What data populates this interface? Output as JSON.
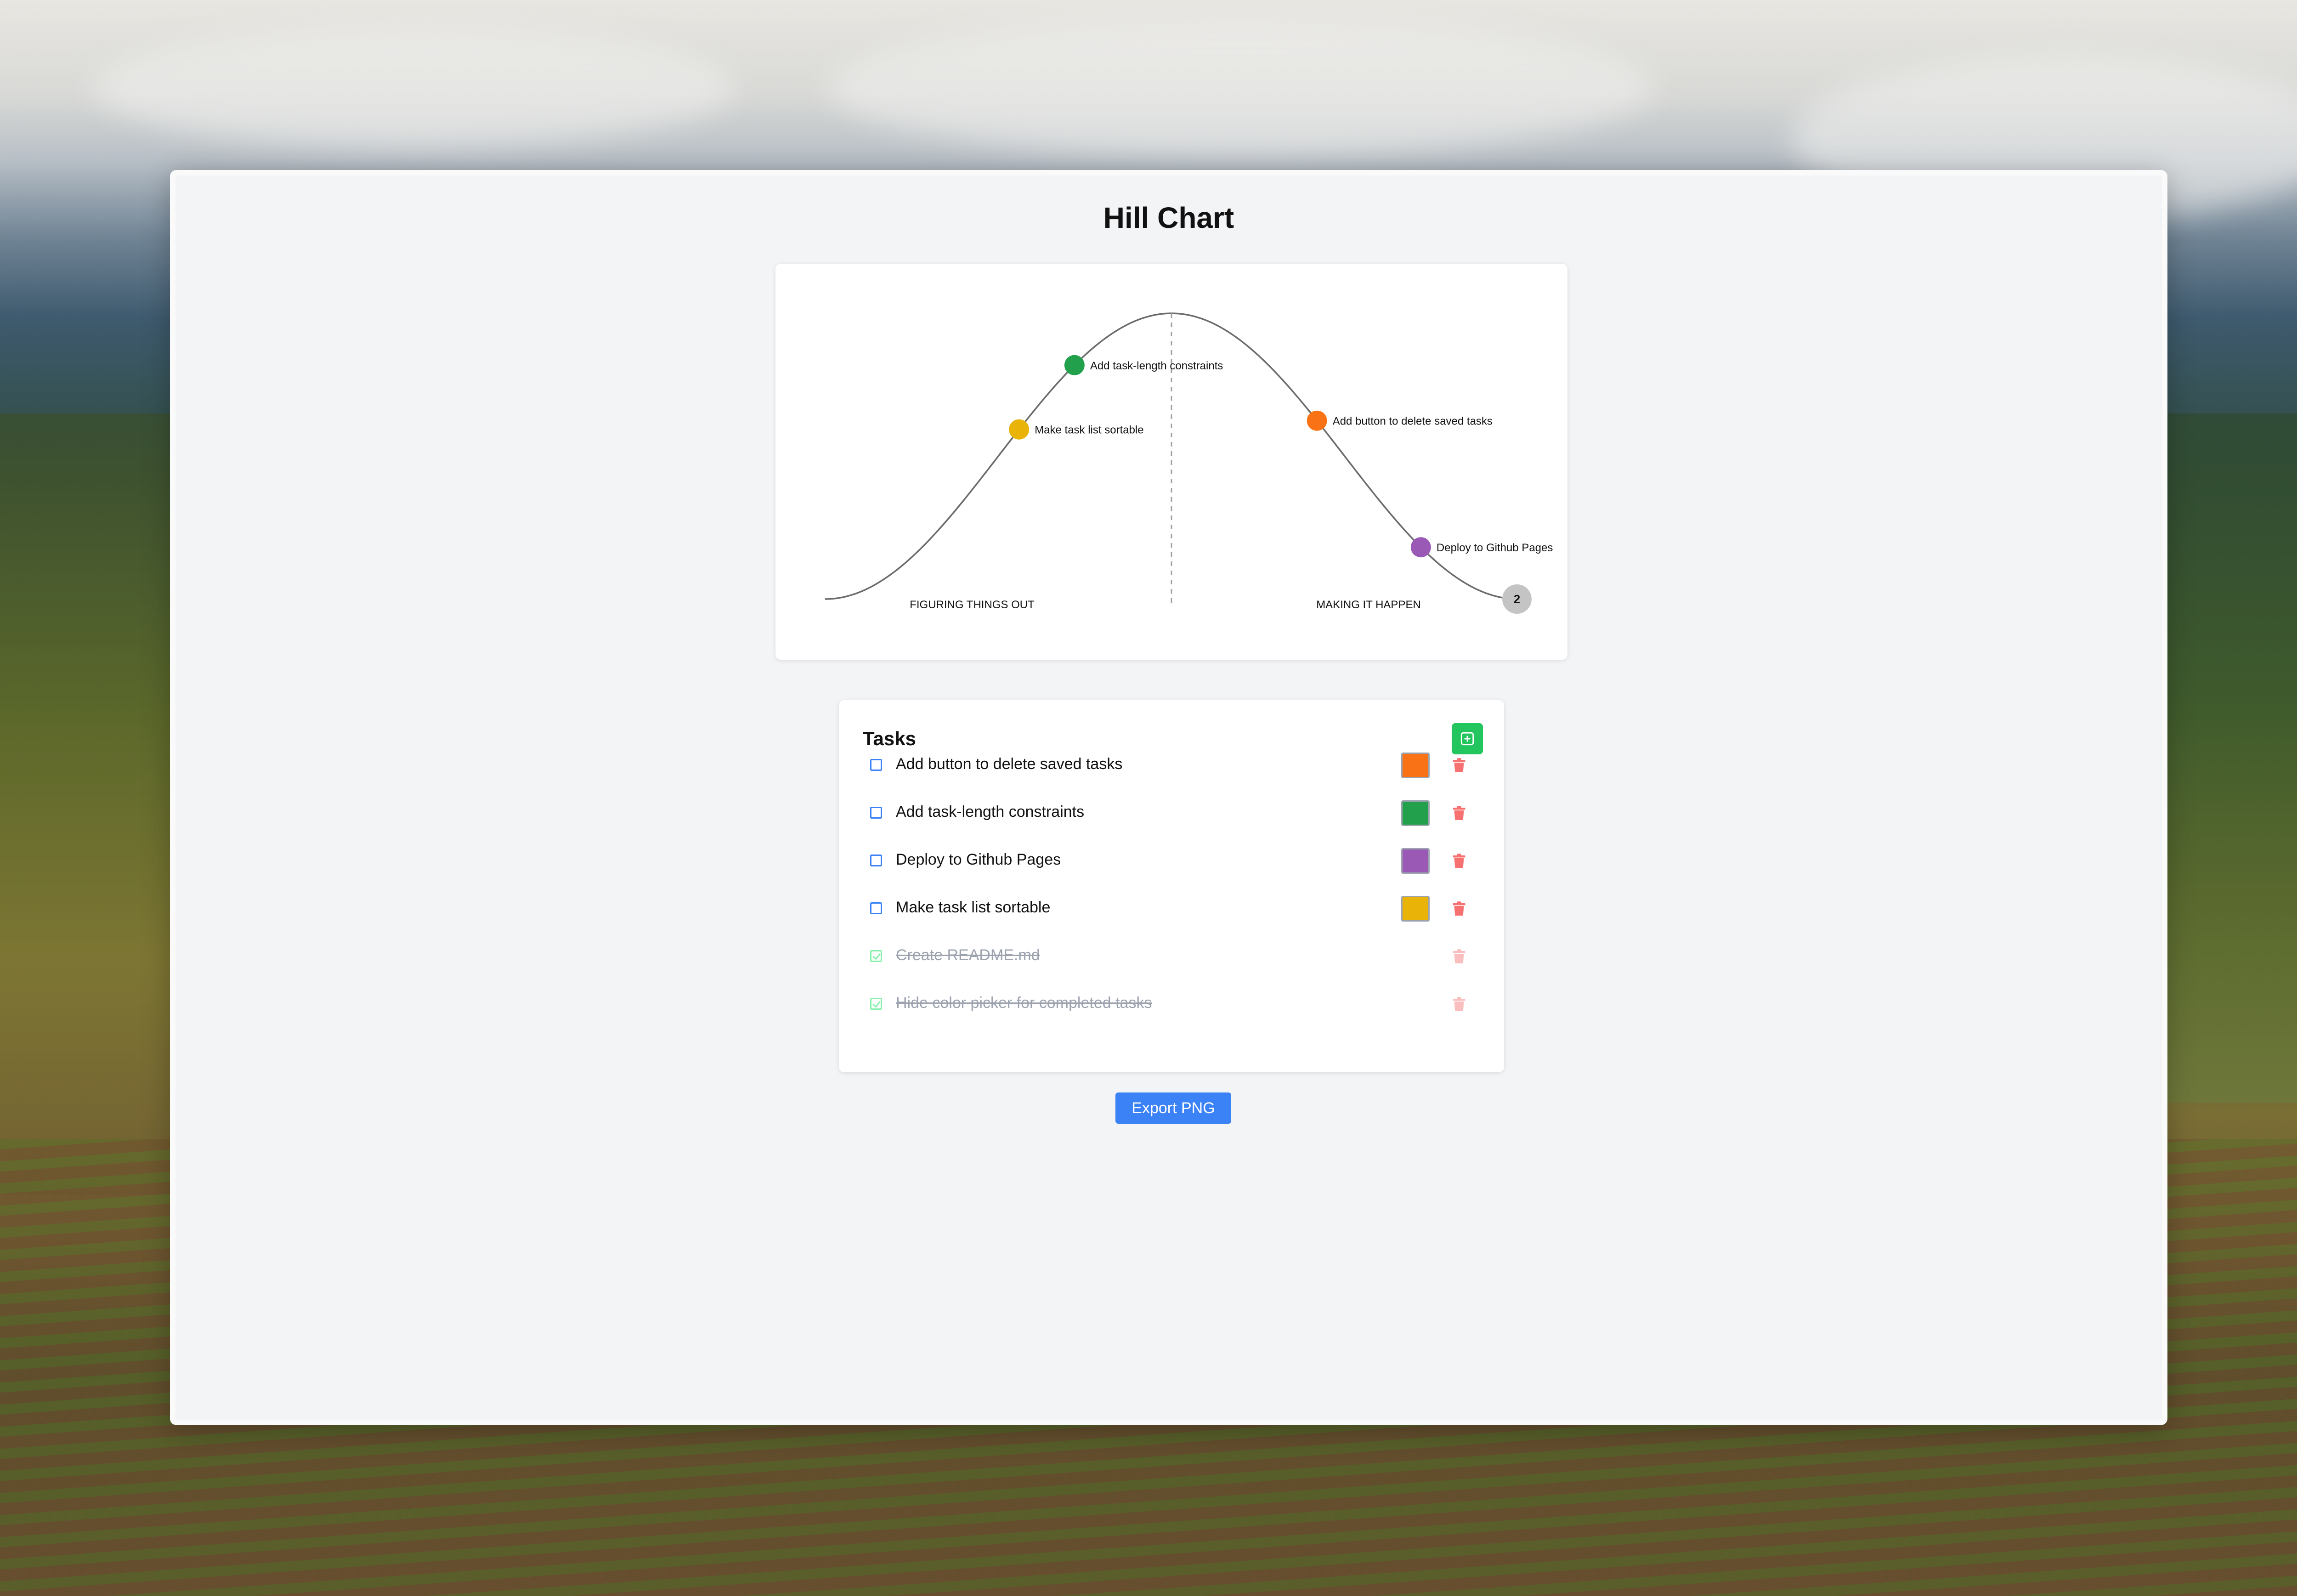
{
  "app": {
    "title": "Hill Chart"
  },
  "chart_data": {
    "type": "scatter",
    "title": "",
    "regions": [
      "FIGURING THINGS OUT",
      "MAKING IT HAPPEN"
    ],
    "points": [
      {
        "label": "Make task list sortable",
        "progress": 0.28,
        "color": "#eab308"
      },
      {
        "label": "Add task-length constraints",
        "progress": 0.36,
        "color": "#22a04b"
      },
      {
        "label": "Add button to delete saved tasks",
        "progress": 0.71,
        "color": "#f97316"
      },
      {
        "label": "Deploy to Github Pages",
        "progress": 0.86,
        "color": "#9b59b6"
      }
    ],
    "completed_cluster": {
      "count_label": "2",
      "progress": 1.0,
      "color": "#c4c4c4"
    }
  },
  "tasks": {
    "heading": "Tasks",
    "add_icon": "plus-square-icon",
    "delete_icon": "trash-icon",
    "items": [
      {
        "label": "Add button to delete saved tasks",
        "done": false,
        "color": "#f97316"
      },
      {
        "label": "Add task-length constraints",
        "done": false,
        "color": "#22a04b"
      },
      {
        "label": "Deploy to Github Pages",
        "done": false,
        "color": "#9b59b6"
      },
      {
        "label": "Make task list sortable",
        "done": false,
        "color": "#eab308"
      },
      {
        "label": "Create README.md",
        "done": true,
        "color": null
      },
      {
        "label": "Hide color picker for completed tasks",
        "done": true,
        "color": null
      }
    ]
  },
  "export": {
    "label": "Export PNG"
  },
  "colors": {
    "accent_green": "#22c55e",
    "accent_blue": "#3b82f6",
    "delete_red": "#f87171"
  }
}
